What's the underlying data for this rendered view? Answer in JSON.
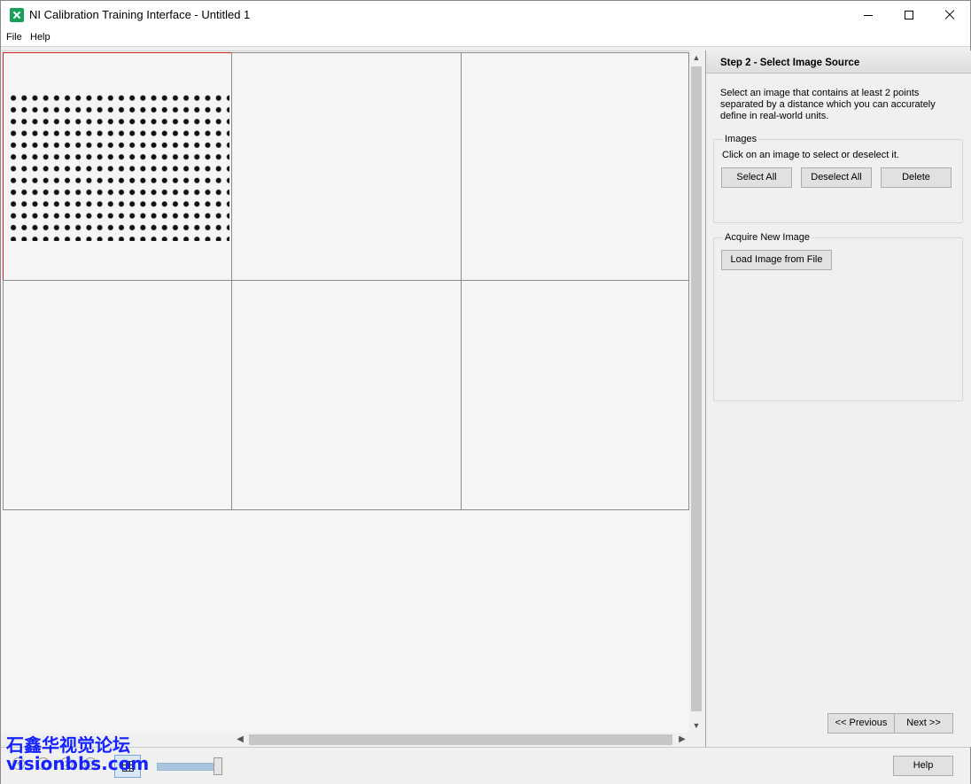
{
  "window": {
    "title": "NI Calibration Training Interface - Untitled 1"
  },
  "menu": {
    "items": [
      "File",
      "Help"
    ]
  },
  "panel": {
    "step_title": "Step 2 - Select Image Source",
    "instructions": "Select an image that contains at least 2 points separated by a distance which you can accurately define in real-world units.",
    "images_group": {
      "label": "Images",
      "hint": "Click on an image to select or deselect it.",
      "select_all": "Select All",
      "deselect_all": "Deselect All",
      "delete": "Delete"
    },
    "acquire_group": {
      "label": "Acquire New Image",
      "load_from_file": "Load Image from File"
    },
    "previous": "<< Previous",
    "next": "Next >>"
  },
  "bottom_bar": {
    "help": "Help"
  },
  "watermark": {
    "line1": "石鑫华视觉论坛",
    "line2": "visionbbs.com"
  }
}
